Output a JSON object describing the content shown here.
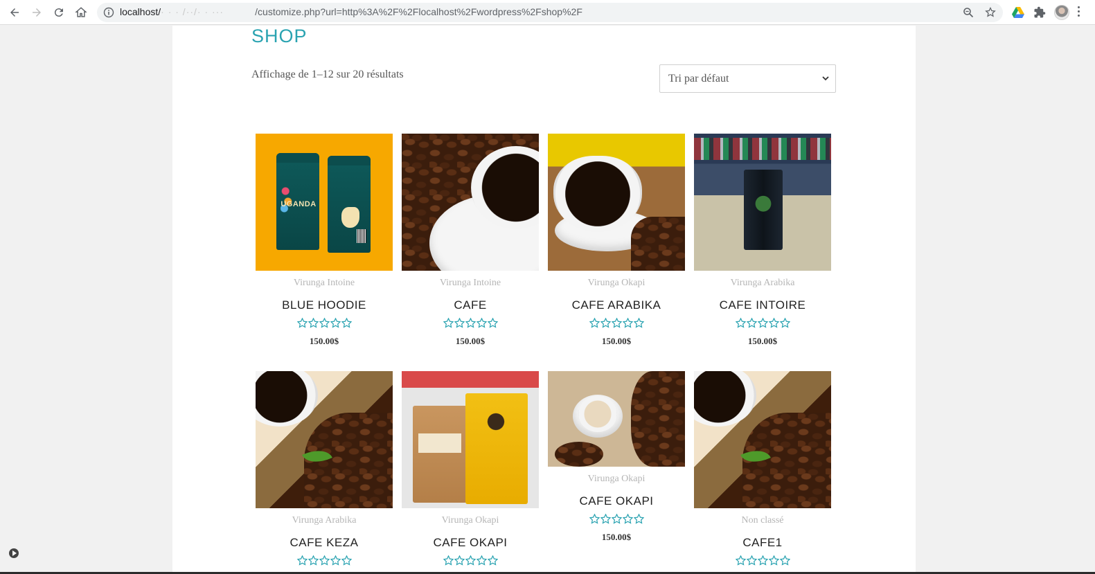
{
  "browser": {
    "url_host": "localhost/",
    "url_masked": "· · · /··/· · ···",
    "url_path": "/customize.php?url=http%3A%2F%2Flocalhost%2Fwordpress%2Fshop%2F"
  },
  "page": {
    "title": "SHOP",
    "result_count": "Affichage de 1–12 sur 20 résultats",
    "sort": {
      "selected": "Tri par défaut"
    },
    "accent_color": "#2aa3b1"
  },
  "products": [
    {
      "category": "Virunga Intoine",
      "name": "BLUE HOODIE",
      "price": "150.00$",
      "rating": 0
    },
    {
      "category": "Virunga Intoine",
      "name": "CAFE",
      "price": "150.00$",
      "rating": 0
    },
    {
      "category": "Virunga Okapi",
      "name": "CAFE ARABIKA",
      "price": "150.00$",
      "rating": 0
    },
    {
      "category": "Virunga Arabika",
      "name": "CAFE INTOIRE",
      "price": "150.00$",
      "rating": 0
    },
    {
      "category": "Virunga Arabika",
      "name": "CAFE KEZA",
      "price": "",
      "rating": 0
    },
    {
      "category": "Virunga Okapi",
      "name": "CAFE OKAPI",
      "price": "",
      "rating": 0
    },
    {
      "category": "Virunga Okapi",
      "name": "CAFE OKAPI",
      "price": "150.00$",
      "rating": 0
    },
    {
      "category": "Non classé",
      "name": "CAFE1",
      "price": "",
      "rating": 0
    }
  ],
  "product_images": {
    "p1_bag_label": "UGANDA"
  }
}
